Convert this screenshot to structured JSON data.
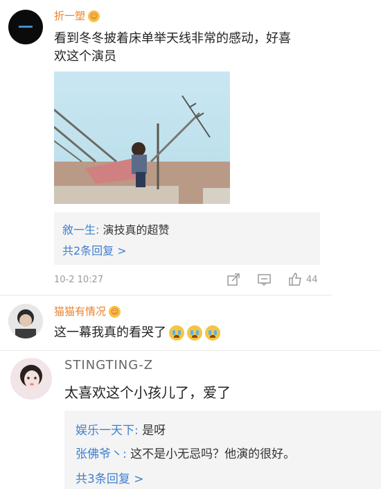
{
  "comments": [
    {
      "username": "折一塑",
      "text_line1": "看到冬冬披着床单举天线非常的感动，好喜",
      "text_line2": "欢这个演员",
      "reply_user": "敘一生:",
      "reply_text": "演技真的超赞",
      "reply_more": "共2条回复 >",
      "time": "10-2 10:27",
      "like_count": "44"
    },
    {
      "username": "猫猫有情况",
      "text": "这一幕我真的看哭了"
    },
    {
      "username": "STINGTING-Z",
      "text": "太喜欢这个小孩儿了，爱了",
      "replies": [
        {
          "user": "娱乐一天下:",
          "text": "是呀"
        },
        {
          "user": "张佛爷丶:",
          "text": "这不是小无忌吗？他演的很好。"
        }
      ],
      "reply_more": "共3条回复 >"
    }
  ],
  "colors": {
    "username": "#e9832f",
    "link": "#3f7fcf",
    "sky": "#bfe3ef"
  }
}
